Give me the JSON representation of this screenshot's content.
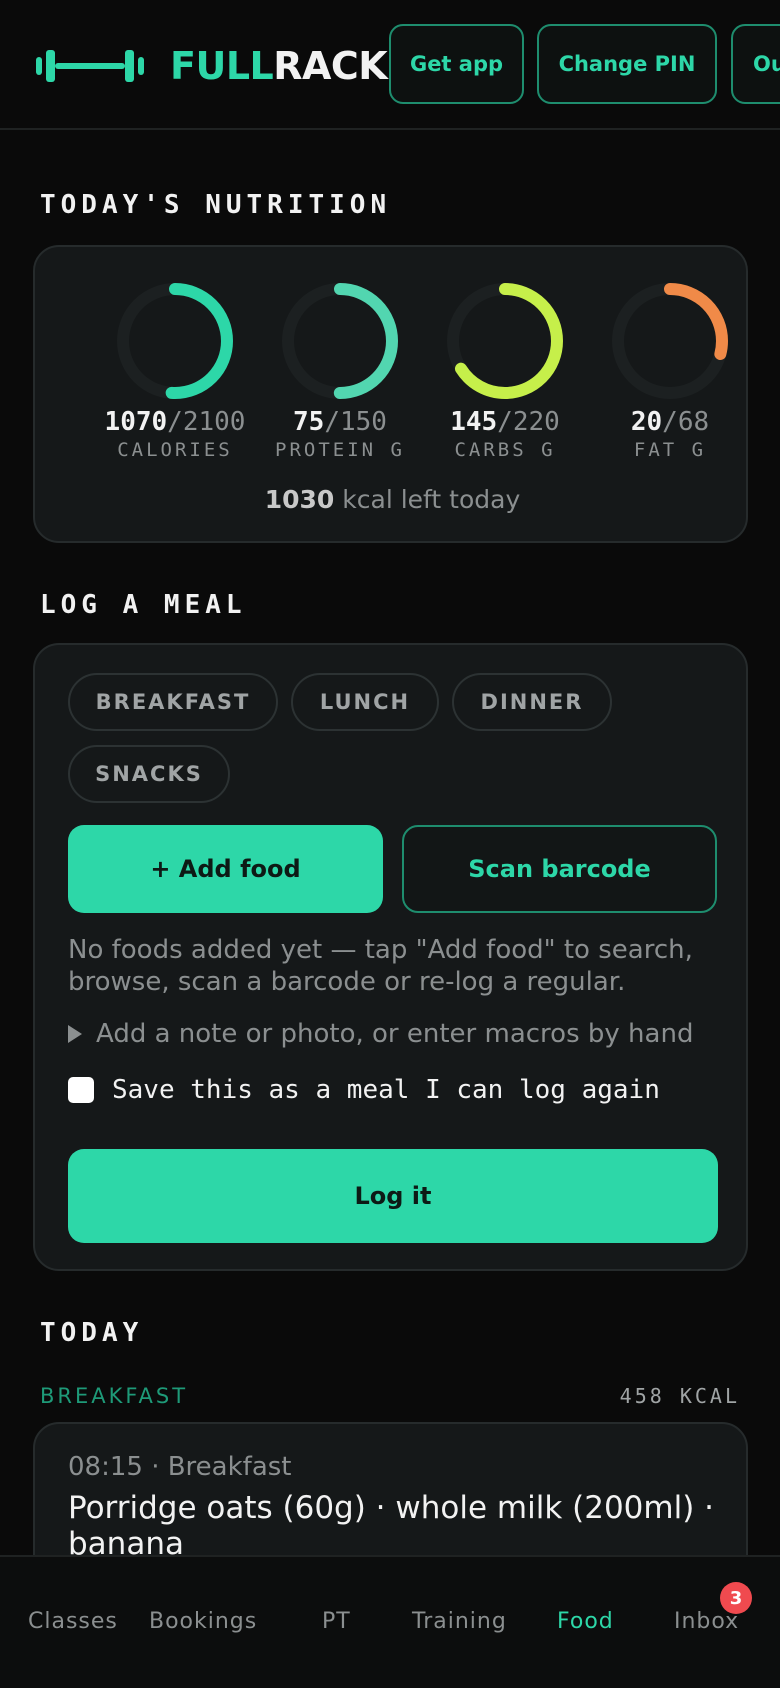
{
  "header": {
    "brand_part1": "FULL",
    "brand_part2": "RACK",
    "buttons": [
      "Get app",
      "Change PIN",
      "Out"
    ]
  },
  "nutrition": {
    "title": "TODAY'S NUTRITION",
    "rings": [
      {
        "current": "1070",
        "target": "2100",
        "label": "CALORIES",
        "fraction": 0.51,
        "color": "#2dd7a8"
      },
      {
        "current": "75",
        "target": "150",
        "label": "PROTEIN G",
        "fraction": 0.5,
        "color": "#52d6b0"
      },
      {
        "current": "145",
        "target": "220",
        "label": "CARBS G",
        "fraction": 0.66,
        "color": "#c6ef4a"
      },
      {
        "current": "20",
        "target": "68",
        "label": "FAT G",
        "fraction": 0.29,
        "color": "#f08a48"
      }
    ],
    "sep": "/",
    "left_value": "1030",
    "left_text": " kcal left today"
  },
  "log_meal": {
    "title": "LOG A MEAL",
    "chips": [
      "BREAKFAST",
      "LUNCH",
      "DINNER",
      "SNACKS"
    ],
    "add_food": "+ Add food",
    "scan_barcode": "Scan barcode",
    "hint": "No foods added yet — tap \"Add food\" to search, browse, scan a barcode or re-log a regular.",
    "disclosure": "Add a note or photo, or enter macros by hand",
    "save_meal": "Save this as a meal I can log again",
    "log_it": "Log it"
  },
  "today": {
    "title": "TODAY",
    "meal": "BREAKFAST",
    "kcal": "458 KCAL",
    "entry_time": "08:15 · Breakfast",
    "entry_desc": "Porridge oats (60g) · whole milk (200ml) · banana"
  },
  "tabs": {
    "items": [
      "Classes",
      "Bookings",
      "PT",
      "Training",
      "Food",
      "Inbox"
    ],
    "active": "Food",
    "inbox_badge": "3"
  }
}
